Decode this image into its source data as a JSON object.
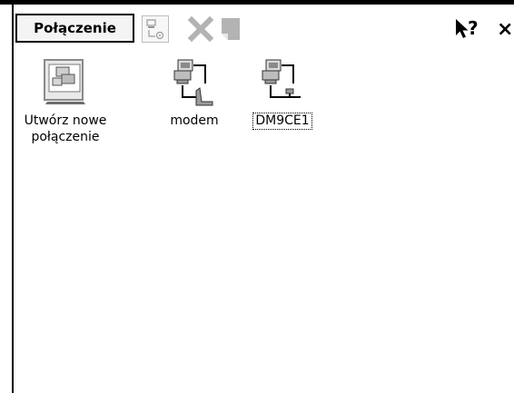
{
  "toolbar": {
    "menu_label": "Połączenie",
    "icons": [
      "connection-properties-icon",
      "delete-icon",
      "document-icon",
      "help-pointer-icon",
      "close-icon"
    ],
    "help_label": "?",
    "close_label": "×"
  },
  "items": [
    {
      "label_line1": "Utwórz nowe",
      "label_line2": "połączenie",
      "icon": "new-connection-icon",
      "selected": false
    },
    {
      "label": "modem",
      "icon": "modem-connection-icon",
      "selected": false
    },
    {
      "label": "DM9CE1",
      "icon": "network-connection-icon",
      "selected": true
    }
  ],
  "colors": {
    "background": "#ffffff",
    "frame": "#000000",
    "disabled": "#b0b0b0"
  }
}
